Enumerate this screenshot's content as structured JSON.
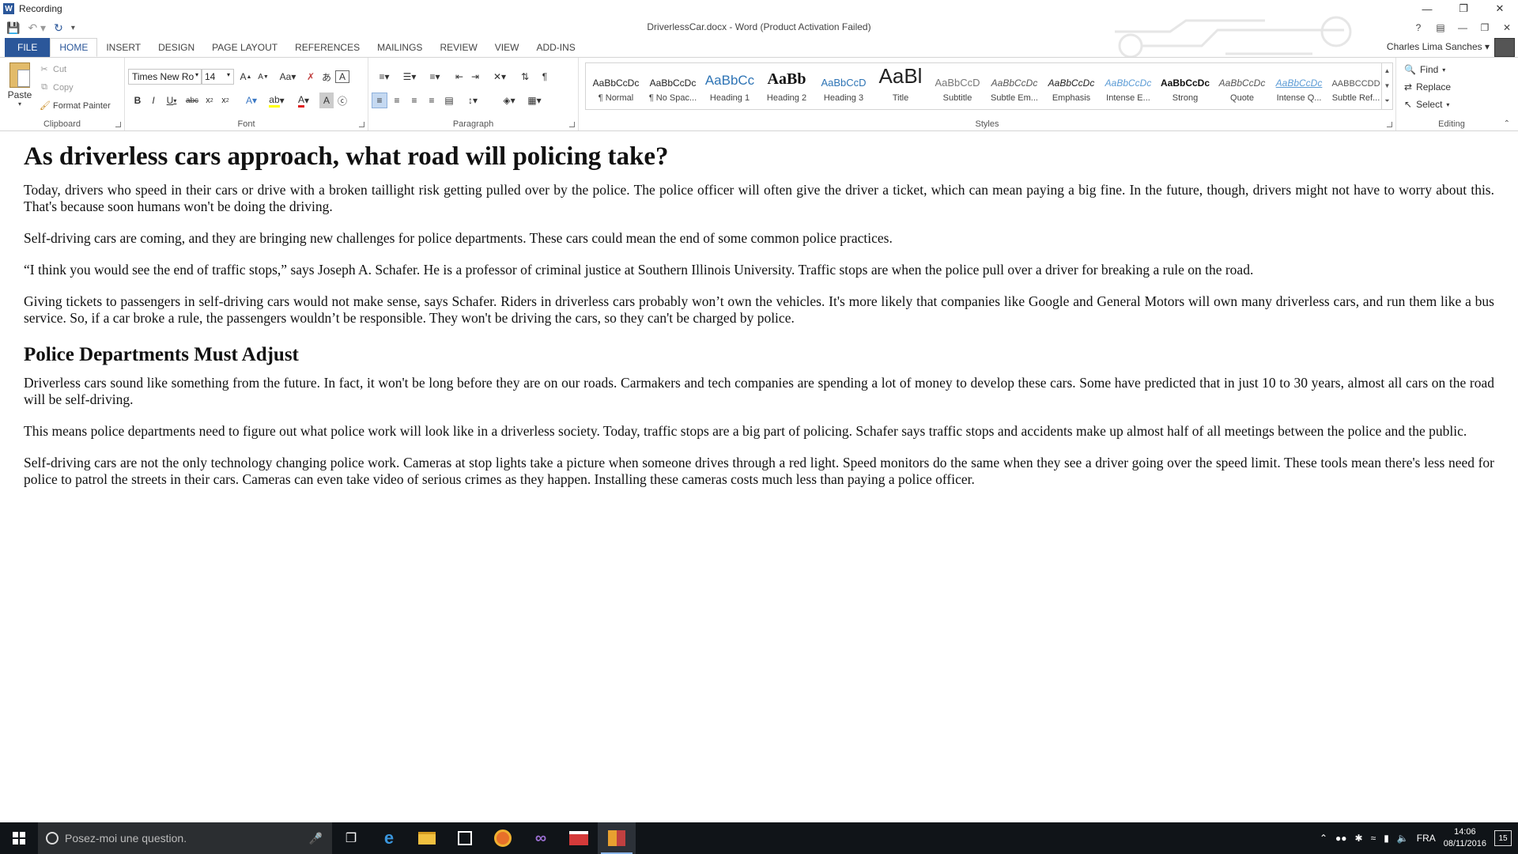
{
  "recording_window": {
    "title": "Recording",
    "badge": "W"
  },
  "word": {
    "title": "DriverlessCar.docx - Word (Product Activation Failed)",
    "user": "Charles Lima Sanches"
  },
  "tabs": [
    "FILE",
    "HOME",
    "INSERT",
    "DESIGN",
    "PAGE LAYOUT",
    "REFERENCES",
    "MAILINGS",
    "REVIEW",
    "VIEW",
    "ADD-INS"
  ],
  "active_tab": "HOME",
  "clipboard": {
    "label": "Clipboard",
    "paste": "Paste",
    "cut": "Cut",
    "copy": "Copy",
    "format_painter": "Format Painter"
  },
  "font": {
    "label": "Font",
    "family": "Times New Ro",
    "size": "14"
  },
  "paragraph": {
    "label": "Paragraph"
  },
  "styles": {
    "label": "Styles",
    "items": [
      {
        "sample": "AaBbCcDc",
        "name": "¶ Normal"
      },
      {
        "sample": "AaBbCcDc",
        "name": "¶ No Spac..."
      },
      {
        "sample": "AaBbCc",
        "name": "Heading 1"
      },
      {
        "sample": "AaBb",
        "name": "Heading 2"
      },
      {
        "sample": "AaBbCcD",
        "name": "Heading 3"
      },
      {
        "sample": "AaBl",
        "name": "Title"
      },
      {
        "sample": "AaBbCcD",
        "name": "Subtitle"
      },
      {
        "sample": "AaBbCcDc",
        "name": "Subtle Em..."
      },
      {
        "sample": "AaBbCcDc",
        "name": "Emphasis"
      },
      {
        "sample": "AaBbCcDc",
        "name": "Intense E..."
      },
      {
        "sample": "AaBbCcDc",
        "name": "Strong"
      },
      {
        "sample": "AaBbCcDc",
        "name": "Quote"
      },
      {
        "sample": "AaBbCcDc",
        "name": "Intense Q..."
      },
      {
        "sample": "AABBCCDD",
        "name": "Subtle Ref..."
      }
    ]
  },
  "editing": {
    "label": "Editing",
    "find": "Find",
    "replace": "Replace",
    "select": "Select"
  },
  "document": {
    "title": "As driverless cars approach, what road will policing take?",
    "p1": "Today, drivers who speed in their cars or drive with a broken taillight risk getting pulled over by the police. The police officer will often give the driver a ticket, which can mean paying a big fine. In the future, though, drivers might not have to worry about this. That's because soon humans won't be doing the driving.",
    "p2": "Self-driving cars are coming, and they are bringing new challenges for police departments. These cars could mean the end of some common police practices.",
    "p3": "“I think you would see the end of traffic stops,” says Joseph A. Schafer. He is a professor of criminal justice at Southern Illinois University. Traffic stops are when the police pull over a driver for breaking a rule on the road.",
    "p4": "Giving tickets to passengers in self-driving cars would not make sense, says Schafer. Riders in driverless cars probably won’t own the vehicles. It's more likely that companies like Google and General Motors will own many driverless cars, and run them like a bus service. So, if a car broke a rule, the passengers wouldn’t be responsible. They won't be driving the cars, so they can't be charged by police.",
    "heading2": "Police Departments Must Adjust",
    "p5": "Driverless cars sound like something from the future. In fact, it won't be long before they are on our roads. Carmakers and tech companies are spending a lot of money to develop these cars. Some have predicted that in just 10 to 30 years, almost all cars on the road will be self-driving.",
    "p6": "This means police departments need to figure out what police work will look like in a driverless society. Today, traffic stops are a big part of policing. Schafer says traffic stops and accidents make up almost half of all meetings between the police and the public.",
    "p7": "Self-driving cars are not the only technology changing police work. Cameras at stop lights take a picture when someone drives through a red light. Speed monitors do the same when they see a driver going over the speed limit. These tools mean there's less need for police to patrol the streets in their cars. Cameras can even take video of serious crimes as they happen. Installing these cameras costs much less than paying a police officer."
  },
  "taskbar": {
    "search_placeholder": "Posez-moi une question.",
    "language": "FRA",
    "time": "14:06",
    "date": "08/11/2016",
    "notifications": "15"
  }
}
